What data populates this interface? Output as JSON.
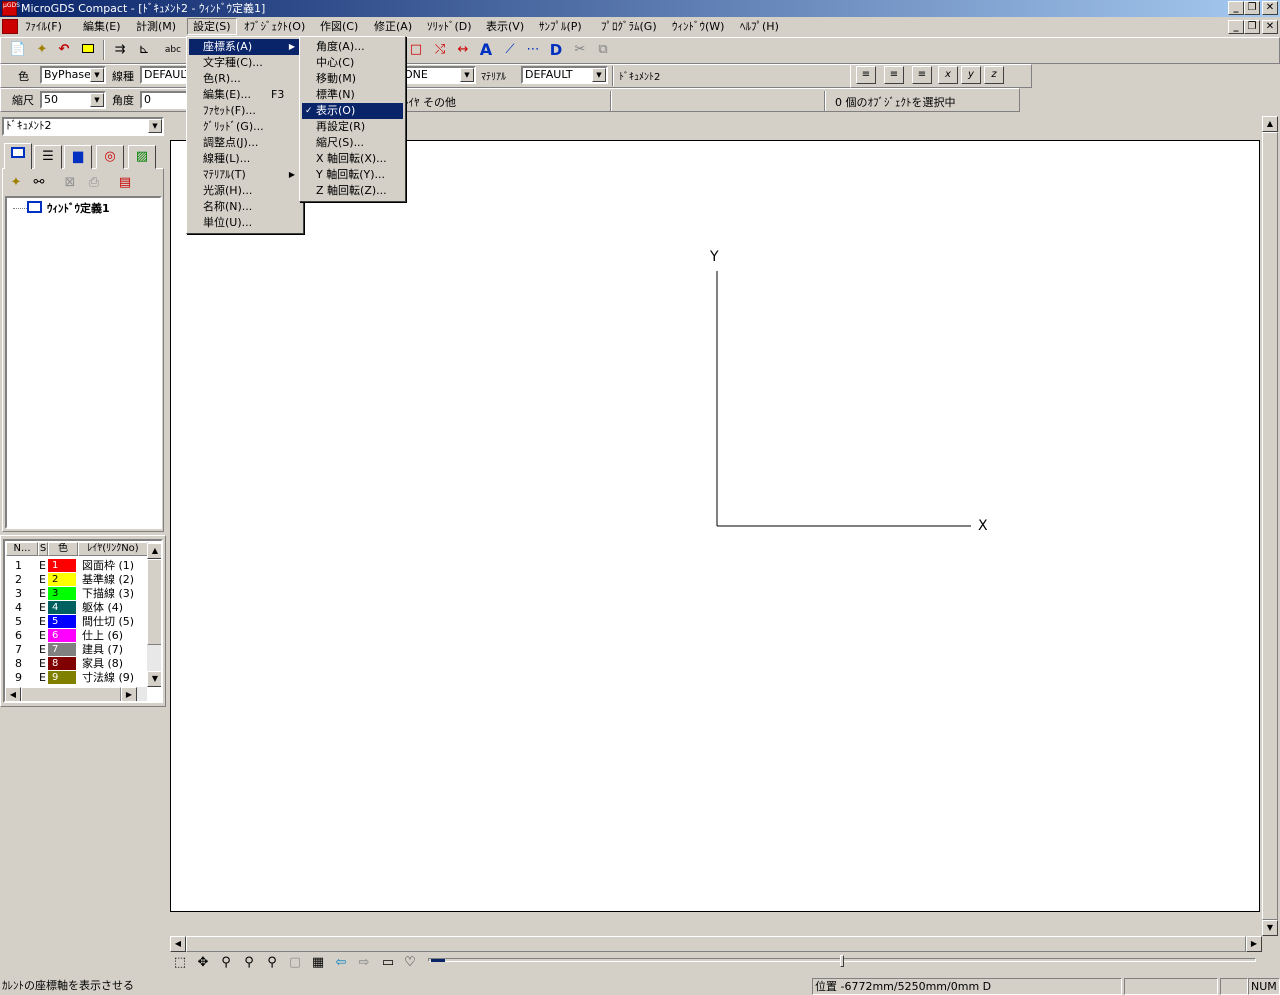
{
  "window": {
    "title": "MicroGDS Compact - [ﾄﾞｷｭﾒﾝﾄ2 - ｳｨﾝﾄﾞｳ定義1]",
    "app_icon_text": "μGDS"
  },
  "menubar": [
    "ﾌｧｲﾙ(F)",
    "編集(E)",
    "計測(M)",
    "設定(S)",
    "ｵﾌﾞｼﾞｪｸﾄ(O)",
    "作図(C)",
    "修正(A)",
    "ｿﾘｯﾄﾞ(D)",
    "表示(V)",
    "ｻﾝﾌﾟﾙ(P)",
    "ﾌﾟﾛｸﾞﾗﾑ(G)",
    "ｳｨﾝﾄﾞｳ(W)",
    "ﾍﾙﾌﾟ(H)"
  ],
  "toolbar2": {
    "color_label": "色",
    "color_value": "ByPhase",
    "linetype_label": "線種",
    "linetype_value": "DEFAULT",
    "material_partial": "ONE",
    "material_label": "ﾏﾃﾘｱﾙ",
    "material_value": "DEFAULT",
    "document_name": "ﾄﾞｷｭﾒﾝﾄ2"
  },
  "toolbar3": {
    "scale_label": "縮尺",
    "scale_value": "50",
    "angle_label": "角度",
    "angle_value": "0",
    "layer_text": "ﾚｲﾔ その他",
    "selection_status": "0 個のｵﾌﾞｼﾞｪｸﾄを選択中"
  },
  "left_panel": {
    "document_combo": "ﾄﾞｷｭﾒﾝﾄ2",
    "tree_item": "ｳｨﾝﾄﾞｳ定義1",
    "layer_headers": [
      "N...",
      "S",
      "色",
      "ﾚｲﾔ(ﾘﾝｸNo)"
    ],
    "layers": [
      {
        "n": "1",
        "s": "E",
        "swatch": "1",
        "color": "#ff0000",
        "swatch_text": "#ffffff",
        "name": "図面枠 (1)"
      },
      {
        "n": "2",
        "s": "E",
        "swatch": "2",
        "color": "#ffff00",
        "swatch_text": "#000000",
        "name": "基準線 (2)"
      },
      {
        "n": "3",
        "s": "E",
        "swatch": "3",
        "color": "#00ff00",
        "swatch_text": "#000000",
        "name": "下描線 (3)"
      },
      {
        "n": "4",
        "s": "E",
        "swatch": "4",
        "color": "#006060",
        "swatch_text": "#ffffff",
        "name": "躯体 (4)"
      },
      {
        "n": "5",
        "s": "E",
        "swatch": "5",
        "color": "#0000ff",
        "swatch_text": "#ffffff",
        "name": "間仕切 (5)"
      },
      {
        "n": "6",
        "s": "E",
        "swatch": "6",
        "color": "#ff00ff",
        "swatch_text": "#ffffff",
        "name": "仕上 (6)"
      },
      {
        "n": "7",
        "s": "E",
        "swatch": "7",
        "color": "#808080",
        "swatch_text": "#ffffff",
        "name": "建具 (7)"
      },
      {
        "n": "8",
        "s": "E",
        "swatch": "8",
        "color": "#800000",
        "swatch_text": "#ffffff",
        "name": "家具 (8)"
      },
      {
        "n": "9",
        "s": "E",
        "swatch": "9",
        "color": "#808000",
        "swatch_text": "#ffffff",
        "name": "寸法線 (9)"
      }
    ]
  },
  "settings_menu": [
    {
      "label": "座標系(A)",
      "submenu": true,
      "highlighted": true
    },
    {
      "label": "文字種(C)..."
    },
    {
      "label": "色(R)..."
    },
    {
      "label": "編集(E)...",
      "shortcut": "F3"
    },
    {
      "label": "ﾌｧｾｯﾄ(F)..."
    },
    {
      "label": "ｸﾞﾘｯﾄﾞ(G)..."
    },
    {
      "label": "調整点(J)..."
    },
    {
      "label": "線種(L)..."
    },
    {
      "label": "ﾏﾃﾘｱﾙ(T)",
      "submenu": true
    },
    {
      "label": "光源(H)..."
    },
    {
      "label": "名称(N)..."
    },
    {
      "label": "単位(U)..."
    }
  ],
  "coord_submenu": [
    {
      "label": "角度(A)..."
    },
    {
      "label": "中心(C)"
    },
    {
      "label": "移動(M)"
    },
    {
      "label": "標準(N)"
    },
    {
      "label": "表示(O)",
      "checked": true,
      "highlighted": true
    },
    {
      "label": "再設定(R)"
    },
    {
      "label": "縮尺(S)..."
    },
    {
      "label": "X 軸回転(X)..."
    },
    {
      "label": "Y 軸回転(Y)..."
    },
    {
      "label": "Z 軸回転(Z)..."
    }
  ],
  "canvas": {
    "axis_x_label": "X",
    "axis_y_label": "Y"
  },
  "statusbar": {
    "hint": "ｶﾚﾝﾄの座標軸を表示させる",
    "position": "位置 -6772mm/5250mm/0mm D",
    "num": "NUM"
  },
  "toolbar_icons": [
    "new-icon",
    "open-icon",
    "undo-icon",
    "select-icon",
    "measure-icon",
    "dimension-icon",
    "text-icon"
  ]
}
